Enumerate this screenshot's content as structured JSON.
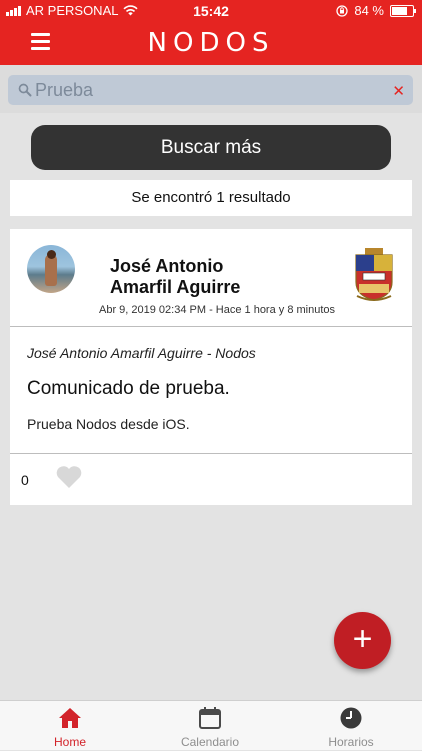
{
  "status_bar": {
    "carrier": "AR PERSONAL",
    "time": "15:42",
    "battery": "84 %",
    "battery_level": 0.84
  },
  "nav": {
    "logo": "NODOS",
    "menu_icon": "hamburger-menu-icon"
  },
  "search": {
    "value": "Prueba",
    "search_icon": "search-icon",
    "clear_icon": "clear-icon"
  },
  "buscar_mas_label": "Buscar más",
  "result_count_text": "Se encontró 1 resultado",
  "post": {
    "author_line1": "José Antonio",
    "author_line2": "Amarfil Aguirre",
    "date": "Abr 9, 2019 02:34 PM - Hace 1 hora y 8 minutos",
    "source": "José Antonio Amarfil Aguirre - Nodos",
    "title": "Comunicado de prueba.",
    "body": "Prueba Nodos desde iOS.",
    "likes": "0",
    "like_icon": "heart-icon"
  },
  "fab_label": "+",
  "tabs": [
    {
      "label": "Home",
      "icon": "home-icon",
      "active": true
    },
    {
      "label": "Calendario",
      "icon": "calendar-icon",
      "active": false
    },
    {
      "label": "Horarios",
      "icon": "clock-icon",
      "active": false
    }
  ],
  "colors": {
    "brand_red": "#e52421",
    "fab_red": "#c01e24",
    "button_dark": "#333333",
    "active_tab": "#d2232a"
  }
}
